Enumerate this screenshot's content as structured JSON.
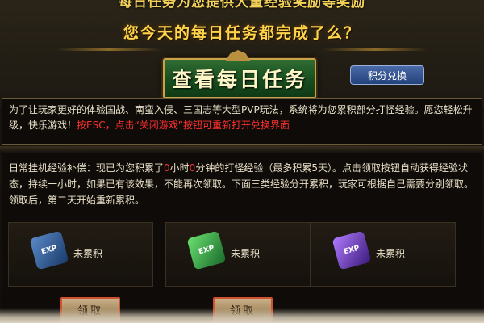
{
  "header": {
    "clipped_title": "每日任务为您提供大量经验奖励等奖励",
    "main_title": "您今天的每日任务都完成了么？",
    "view_tasks_label": "查看每日任务",
    "points_exchange_label": "积分兑换"
  },
  "notice": {
    "line1": "为了让玩家更好的体验国战、南蛮入侵、三国志等大型PVP玩法，系统将为您累积部分打怪经验。愿您轻松升级，快乐游戏！",
    "line2_red": "按ESC，点击“关闭游戏”按钮可重新打开兑换界面"
  },
  "exp": {
    "desc_pre": "日常挂机经验补偿：现已为您积累了",
    "hours": "0",
    "hours_unit": "小时",
    "minutes": "0",
    "desc_post": "分钟的打怪经验（最多积累5天）。点击领取按钮自动获得经验状态，持续一小时，如果已有该效果，不能再次领取。下面三类经验分开累积，玩家可根据自己需要分别领取。领取后，第二天开始重新累积。",
    "slots": [
      {
        "label": "未累积",
        "icon": "exp-scroll-blue-icon",
        "color": "#3a6aa0"
      },
      {
        "label": "未累积",
        "icon": "exp-scroll-green-icon",
        "color": "#2aa040"
      },
      {
        "label": "未累积",
        "icon": "exp-scroll-purple-icon",
        "color": "#7a3ac0"
      }
    ],
    "exp_badge": "EXP",
    "claim_label": "领取"
  }
}
